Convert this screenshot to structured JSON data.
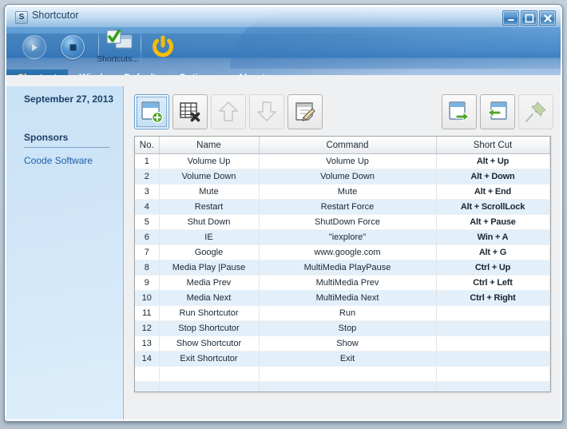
{
  "window": {
    "title": "Shortcutor",
    "icon": "S",
    "minimize_label": "Minimize",
    "maximize_label": "Maximize",
    "close_label": "Close"
  },
  "header_toolbar": {
    "run_label": "Run",
    "stop_label": "Stop",
    "shortcuts_label": "Shortcuts...",
    "power_label": "Power"
  },
  "tabs": [
    {
      "label": "Shortcut",
      "active": true
    },
    {
      "label": "Windows Default",
      "active": false
    },
    {
      "label": "Options",
      "active": false
    },
    {
      "label": "About",
      "active": false
    }
  ],
  "sidebar": {
    "date": "September 27, 2013",
    "sponsors_heading": "Sponsors",
    "sponsor_link": "Coode Software"
  },
  "toolbar": {
    "left_buttons": [
      {
        "name": "add-shortcut-button",
        "title": "Add",
        "selected": true,
        "disabled": false
      },
      {
        "name": "delete-shortcut-button",
        "title": "Delete",
        "selected": false,
        "disabled": false
      },
      {
        "name": "move-up-button",
        "title": "Move Up",
        "selected": false,
        "disabled": true
      },
      {
        "name": "move-down-button",
        "title": "Move Down",
        "selected": false,
        "disabled": true
      },
      {
        "name": "edit-shortcut-button",
        "title": "Edit",
        "selected": false,
        "disabled": false
      }
    ],
    "right_buttons": [
      {
        "name": "export-button",
        "title": "Export",
        "disabled": false
      },
      {
        "name": "import-button",
        "title": "Import",
        "disabled": false
      },
      {
        "name": "pin-button",
        "title": "Pin",
        "disabled": true
      }
    ]
  },
  "table": {
    "columns": [
      "No.",
      "Name",
      "Command",
      "Short Cut",
      ""
    ],
    "empty_rows": 4,
    "rows": [
      {
        "no": "1",
        "name": "Volume Up",
        "command": "Volume Up",
        "shortcut": "Alt + Up"
      },
      {
        "no": "2",
        "name": "Volume Down",
        "command": "Volume Down",
        "shortcut": "Alt + Down"
      },
      {
        "no": "3",
        "name": "Mute",
        "command": "Mute",
        "shortcut": "Alt + End"
      },
      {
        "no": "4",
        "name": "Restart",
        "command": "Restart Force",
        "shortcut": "Alt + ScrollLock"
      },
      {
        "no": "5",
        "name": "Shut Down",
        "command": "ShutDown Force",
        "shortcut": "Alt + Pause"
      },
      {
        "no": "6",
        "name": "IE",
        "command": "\"iexplore\"",
        "shortcut": "Win + A"
      },
      {
        "no": "7",
        "name": "Google",
        "command": "www.google.com",
        "shortcut": "Alt + G"
      },
      {
        "no": "8",
        "name": "Media Play |Pause",
        "command": "MultiMedia PlayPause",
        "shortcut": "Ctrl + Up"
      },
      {
        "no": "9",
        "name": "Media Prev",
        "command": "MultiMedia Prev",
        "shortcut": "Ctrl + Left"
      },
      {
        "no": "10",
        "name": "Media Next",
        "command": "MultiMedia Next",
        "shortcut": "Ctrl + Right"
      },
      {
        "no": "11",
        "name": "Run Shortcutor",
        "command": "Run",
        "shortcut": ""
      },
      {
        "no": "12",
        "name": "Stop Shortcutor",
        "command": "Stop",
        "shortcut": ""
      },
      {
        "no": "13",
        "name": "Show Shortcutor",
        "command": "Show",
        "shortcut": ""
      },
      {
        "no": "14",
        "name": "Exit Shortcutor",
        "command": "Exit",
        "shortcut": ""
      }
    ]
  },
  "colors": {
    "accent_blue": "#2f76b5",
    "active_tab_text": "#ffe07a",
    "row_alt": "#e3eff9",
    "sidebar_link": "#1b5fa8",
    "green_accent": "#5aa834",
    "power_yellow": "#f5bd08"
  }
}
